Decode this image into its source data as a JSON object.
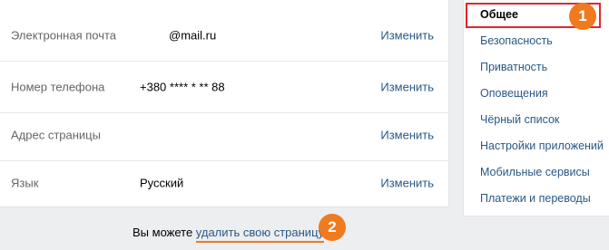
{
  "settings_rows": [
    {
      "label": "Электронная почта",
      "value": "@mail.ru",
      "action": "Изменить"
    },
    {
      "label": "Номер телефона",
      "value": "+380 **** * ** 88",
      "action": "Изменить"
    },
    {
      "label": "Адрес страницы",
      "value": "",
      "action": "Изменить"
    },
    {
      "label": "Язык",
      "value": "Русский",
      "action": "Изменить"
    }
  ],
  "footer": {
    "prefix": "Вы можете ",
    "link": "удалить свою страницу",
    "suffix": "."
  },
  "sidebar": {
    "active": "Общее",
    "items": [
      "Безопасность",
      "Приватность",
      "Оповещения",
      "Чёрный список",
      "Настройки приложений",
      "Мобильные сервисы",
      "Платежи и переводы"
    ]
  },
  "markers": {
    "one": "1",
    "two": "2"
  },
  "colors": {
    "link": "#2a5885",
    "marker": "#f07a1f",
    "highlight": "#e3262e"
  }
}
